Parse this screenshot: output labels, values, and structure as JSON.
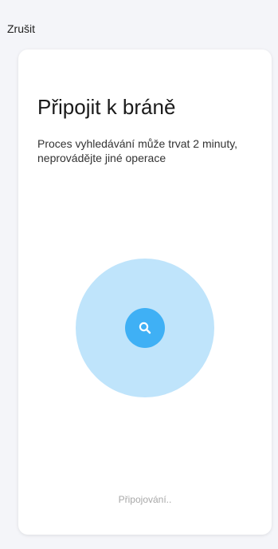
{
  "header": {
    "cancel_label": "Zrušit"
  },
  "card": {
    "title": "Připojit k bráně",
    "subtitle": "Proces vyhledávání může trvat 2 minuty, neprovádějte jiné operace",
    "scan": {
      "icon": "search-icon",
      "outer_color": "#bfe4fb",
      "inner_color": "#3fb0f5"
    },
    "status_text": "Připojování.."
  }
}
